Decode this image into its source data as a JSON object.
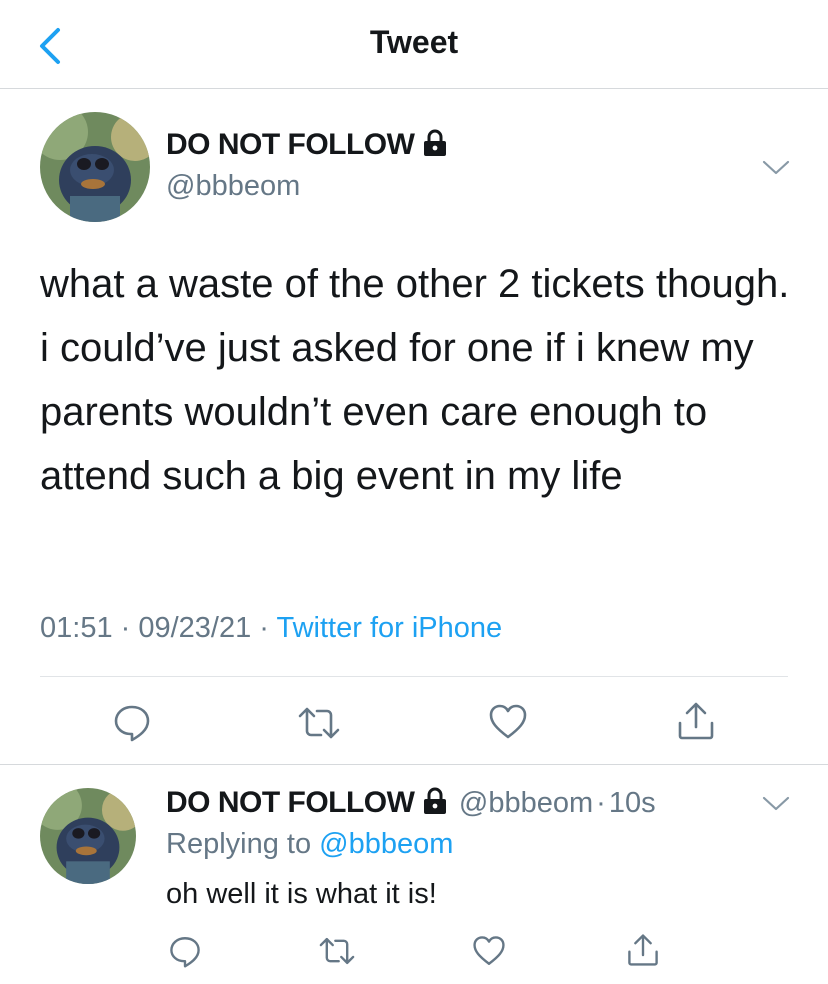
{
  "header": {
    "title": "Tweet"
  },
  "main_tweet": {
    "display_name": "DO NOT FOLLOW",
    "handle": "@bbbeom",
    "text": "what a waste of the other 2 tickets though. i could’ve just asked for one if i knew my parents wouldn’t even care enough to attend such a big event in my life",
    "time": "01:51",
    "date": "09/23/21",
    "source": "Twitter for iPhone",
    "separator": " · "
  },
  "reply_tweet": {
    "display_name": "DO NOT FOLLOW",
    "handle": "@bbbeom",
    "time_ago": "10s",
    "dot": "·",
    "replying_prefix": "Replying to ",
    "replying_to": "@bbbeom",
    "text": "oh well it is what it is!"
  },
  "icons": [
    "back-chevron-icon",
    "lock-icon",
    "chevron-down-icon",
    "reply-icon",
    "retweet-icon",
    "like-icon",
    "share-icon"
  ],
  "colors": {
    "accent": "#1da1f2",
    "secondary_text": "#657786",
    "primary_text": "#14171a",
    "divider": "#e1e4e7"
  }
}
